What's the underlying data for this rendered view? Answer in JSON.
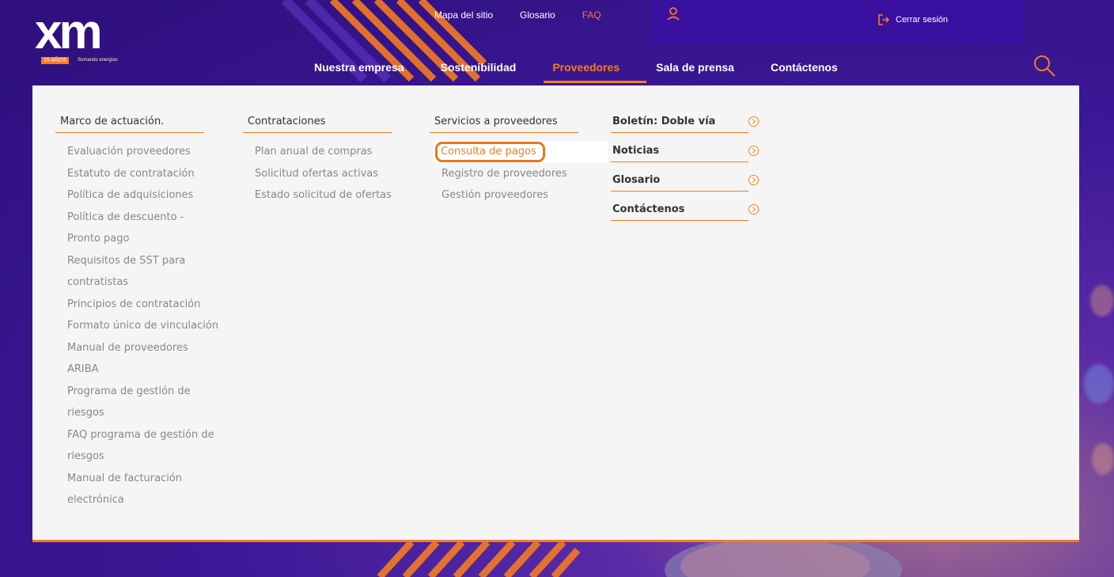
{
  "logo": {
    "text": "xm",
    "badge": "15 AÑOS",
    "tagline": "Sumando energías"
  },
  "toplinks": {
    "sitemap": "Mapa del sitio",
    "glossary": "Glosario",
    "faq": "FAQ"
  },
  "session": {
    "logout_label": "Cerrar sesión"
  },
  "mainnav": [
    {
      "label": "Nuestra empresa"
    },
    {
      "label": "Sostenibilidad"
    },
    {
      "label": "Proveedores",
      "active": true
    },
    {
      "label": "Sala de prensa"
    },
    {
      "label": "Contáctenos"
    }
  ],
  "colors": {
    "accent": "#f47b20",
    "panel_bg": "#f5f5f5",
    "header_bg": "#3a10a0"
  },
  "menu": {
    "col1": {
      "title": "Marco de actuación.",
      "items": [
        "Evaluación proveedores",
        "Estatuto de contratación",
        "Política de adquisiciones",
        "Política de descuento -",
        "Pronto pago",
        "Requisitos de SST para",
        "contratistas",
        "Principios de contratación",
        "Formato único de vinculación",
        "Manual de proveedores",
        "ARIBA",
        "Programa de gestión de",
        "riesgos",
        "FAQ programa de gestión de",
        "riesgos",
        "Manual de facturación",
        "electrónica"
      ]
    },
    "col2": {
      "title": "Contrataciones",
      "items": [
        "Plan anual de compras",
        "Solicitud ofertas activas",
        "Estado solicitud de ofertas"
      ]
    },
    "col3": {
      "title": "Servicios a proveedores",
      "items": [
        "Consulta de pagos",
        "Registro de proveedores",
        "Gestión proveedores"
      ]
    },
    "col4": {
      "items": [
        "Boletín: Doble vía",
        "Noticias",
        "Glosario",
        "Contáctenos"
      ]
    }
  }
}
